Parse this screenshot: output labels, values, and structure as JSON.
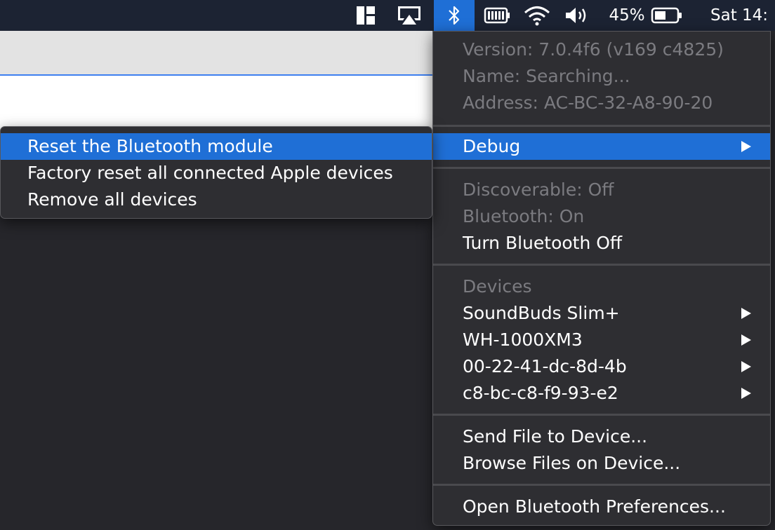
{
  "menubar": {
    "icons": [
      "split-view-icon",
      "airplay-icon",
      "bluetooth-icon",
      "battery-status-icon",
      "wifi-icon",
      "volume-icon",
      "battery-icon"
    ],
    "battery_percent": "45%",
    "clock": "Sat 14:"
  },
  "bluetooth_menu": {
    "version": "Version: 7.0.4f6 (v169 c4825)",
    "name": "Name: Searching...",
    "address": "Address: AC-BC-32-A8-90-20",
    "debug": "Debug",
    "discoverable": "Discoverable: Off",
    "bluetooth_state": "Bluetooth: On",
    "turn_off": "Turn Bluetooth Off",
    "devices_header": "Devices",
    "devices": [
      {
        "label": "SoundBuds Slim+"
      },
      {
        "label": "WH-1000XM3"
      },
      {
        "label": "00-22-41-dc-8d-4b"
      },
      {
        "label": "c8-bc-c8-f9-93-e2"
      }
    ],
    "send_file": "Send File to Device...",
    "browse_files": "Browse Files on Device...",
    "open_prefs": "Open Bluetooth Preferences..."
  },
  "debug_submenu": {
    "items": [
      {
        "label": "Reset the Bluetooth module"
      },
      {
        "label": "Factory reset all connected Apple devices"
      },
      {
        "label": "Remove all devices"
      }
    ]
  },
  "colors": {
    "highlight": "#1f6fd6",
    "menu_bg": "#2e2e32",
    "menubar_bg": "#1c2333",
    "disabled_text": "#7b7b80"
  }
}
